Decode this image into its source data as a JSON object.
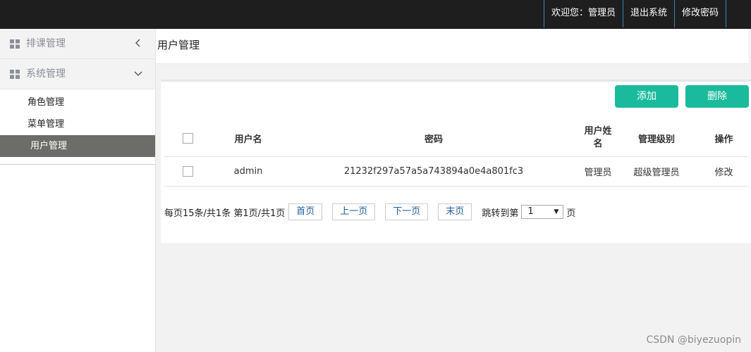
{
  "topbar": {
    "welcome": "欢迎您：管理员",
    "logout": "退出系统",
    "change_password": "修改密码"
  },
  "sidebar": {
    "groups": [
      {
        "label": "排课管理",
        "icon": "grid-icon",
        "state": "collapsed"
      },
      {
        "label": "系统管理",
        "icon": "grid-icon",
        "state": "expanded"
      }
    ],
    "items": [
      {
        "label": "角色管理"
      },
      {
        "label": "菜单管理"
      },
      {
        "label": "用户管理",
        "active": true
      }
    ]
  },
  "main": {
    "title": "用户管理",
    "buttons": {
      "add": "添加",
      "delete": "删除"
    },
    "accent_color": "#1abb9c",
    "table": {
      "columns": [
        "用户名",
        "密码",
        "用户姓名",
        "管理级别",
        "操作"
      ],
      "rows": [
        {
          "username": "admin",
          "password": "21232f297a57a5a743894a0e4a801fc3",
          "name": "管理员",
          "level": "超级管理员",
          "action": "修改"
        }
      ]
    },
    "pager": {
      "summary": "每页15条/共1条 第1页/共1页",
      "first": "首页",
      "prev": "上一页",
      "next": "下一页",
      "last": "末页",
      "jump_label": "跳转到第",
      "page_value": "1",
      "page_suffix": "页"
    }
  },
  "watermark": "CSDN @biyezuopin"
}
